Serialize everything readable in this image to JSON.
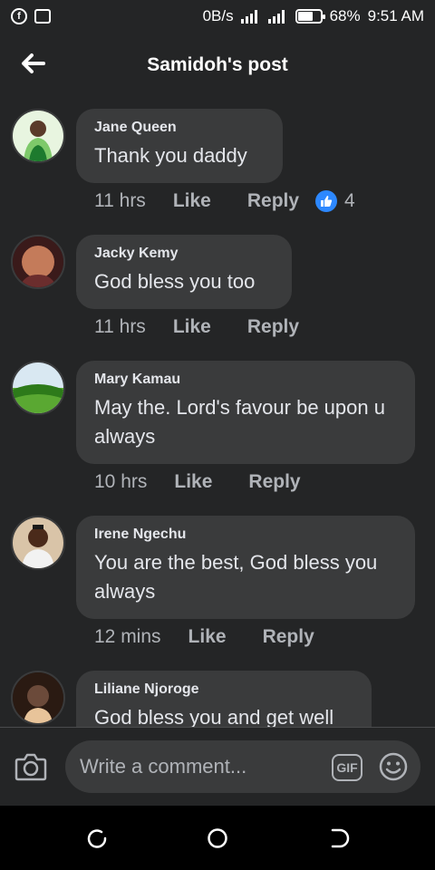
{
  "status_bar": {
    "network_speed": "0B/s",
    "battery_percent": "68%",
    "battery_level": 0.68,
    "time": "9:51 AM",
    "icons": [
      "facebook-icon",
      "image-icon",
      "signal-icon",
      "signal-icon",
      "battery-icon"
    ]
  },
  "header": {
    "title": "Samidoh's post",
    "back_icon": "arrow-left-icon"
  },
  "comments": [
    {
      "author": "Jane Queen",
      "text": "Thank you daddy",
      "time": "11 hrs",
      "like_label": "Like",
      "reply_label": "Reply",
      "reaction_count": "4",
      "avatar_colors": [
        "#7ec96a",
        "#1d7a2e",
        "#e8f5e0"
      ]
    },
    {
      "author": "Jacky Kemy",
      "text": "God bless you too",
      "time": "11 hrs",
      "like_label": "Like",
      "reply_label": "Reply",
      "avatar_colors": [
        "#c47b5a",
        "#6b2d2d",
        "#3a1a1a"
      ]
    },
    {
      "author": "Mary Kamau",
      "text": "May the. Lord's favour  be upon u  always",
      "time": "10 hrs",
      "like_label": "Like",
      "reply_label": "Reply",
      "avatar_colors": [
        "#5aa832",
        "#2d7a1a",
        "#d9e8f2"
      ]
    },
    {
      "author": "Irene Ngechu",
      "text": "You are the best, God bless you always",
      "time": "12 mins",
      "like_label": "Like",
      "reply_label": "Reply",
      "avatar_colors": [
        "#f2f2f2",
        "#1a1a1a",
        "#d9c4a8"
      ]
    },
    {
      "author": "Liliane Njoroge",
      "text": "God bless you and get well",
      "avatar_colors": [
        "#2a1a12",
        "#e8c49a",
        "#6b4a3a"
      ]
    }
  ],
  "composer": {
    "placeholder": "Write a comment...",
    "gif_label": "GIF",
    "camera_icon": "camera-icon",
    "emoji_icon": "smiley-icon"
  },
  "nav_bar": {
    "icons": [
      "recent-apps-icon",
      "home-icon",
      "back-icon"
    ]
  },
  "colors": {
    "background": "#242526",
    "bubble": "#3a3b3c",
    "text": "#e4e6eb",
    "muted": "#b0b3b8",
    "like_blue": "#2d88ff"
  }
}
